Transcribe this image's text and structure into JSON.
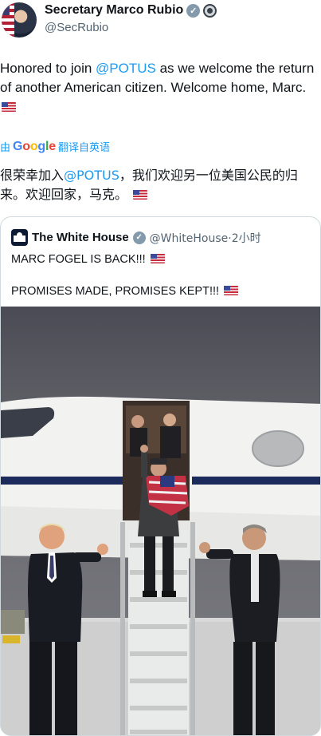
{
  "author": {
    "display_name": "Secretary Marco Rubio",
    "handle": "@SecRubio",
    "avatar_icon": "user-avatar",
    "verified_icon": "verified-badge-icon",
    "affiliate_icon": "government-seal-icon"
  },
  "tweet": {
    "text_before": "Honored to join ",
    "mention": "@POTUS",
    "text_after": " as we welcome the return of another American citizen. Welcome home, Marc.",
    "emoji": "us-flag"
  },
  "translation": {
    "prefix": "由",
    "provider": "Google",
    "label": "翻译自英语"
  },
  "translated_text": {
    "before": "很荣幸加入",
    "mention": "@POTUS",
    "after": "，我们欢迎另一位美国公民的归来。欢迎回家，马克。"
  },
  "quote": {
    "display_name": "The White House",
    "handle": "@WhiteHouse",
    "separator": "·",
    "time": "2小时",
    "line1": "MARC FOGEL IS BACK!!!",
    "line2": "PROMISES MADE, PROMISES KEPT!!!",
    "image_icon": "airplane-arrival-photo"
  },
  "colors": {
    "link": "#1d9bf0",
    "secondary_text": "#536471",
    "border": "#cfd9de"
  }
}
